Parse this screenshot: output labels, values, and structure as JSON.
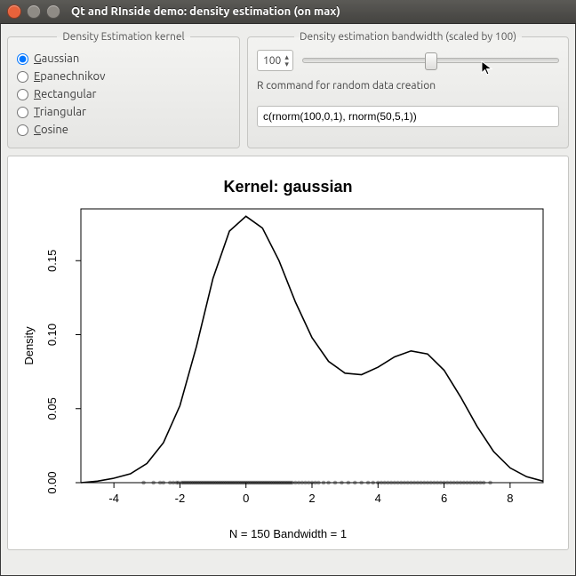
{
  "window": {
    "title": "Qt and RInside demo: density estimation (on max)",
    "buttons": {
      "close": "#e8623b",
      "min": "#8f8b85",
      "max": "#8f8b85"
    }
  },
  "kernel_group": {
    "legend": "Density Estimation kernel",
    "options": [
      {
        "label": "Gaussian",
        "accel": "G",
        "checked": true
      },
      {
        "label": "Epanechnikov",
        "accel": "E",
        "checked": false
      },
      {
        "label": "Rectangular",
        "accel": "R",
        "checked": false
      },
      {
        "label": "Triangular",
        "accel": "T",
        "checked": false
      },
      {
        "label": "Cosine",
        "accel": "C",
        "checked": false
      }
    ]
  },
  "bw_group": {
    "legend": "Density estimation bandwidth (scaled by 100)",
    "spinner_value": "100",
    "slider_pos_pct": 50,
    "cmd_label": "R command for random data creation",
    "cmd_value": "c(rnorm(100,0,1), rnorm(50,5,1))"
  },
  "chart_data": {
    "type": "line",
    "title": "Kernel: gaussian",
    "xlabel": "",
    "ylabel": "Density",
    "xlim": [
      -5,
      9
    ],
    "ylim": [
      0,
      0.185
    ],
    "xticks": [
      -4,
      -2,
      0,
      2,
      4,
      6,
      8
    ],
    "yticks": [
      0.0,
      0.05,
      0.1,
      0.15
    ],
    "caption": "N = 150   Bandwidth = 1",
    "series": [
      {
        "name": "density",
        "x": [
          -5,
          -4.5,
          -4,
          -3.5,
          -3,
          -2.5,
          -2,
          -1.5,
          -1,
          -0.5,
          0,
          0.5,
          1,
          1.5,
          2,
          2.5,
          3,
          3.5,
          4,
          4.5,
          5,
          5.5,
          6,
          6.5,
          7,
          7.5,
          8,
          8.5,
          9
        ],
        "y": [
          0.0,
          0.001,
          0.003,
          0.006,
          0.013,
          0.027,
          0.052,
          0.092,
          0.138,
          0.17,
          0.18,
          0.172,
          0.15,
          0.122,
          0.098,
          0.082,
          0.074,
          0.073,
          0.078,
          0.085,
          0.089,
          0.087,
          0.076,
          0.058,
          0.038,
          0.021,
          0.01,
          0.004,
          0.001
        ]
      }
    ],
    "rug": [
      -3.1,
      -2.8,
      -2.6,
      -2.5,
      -2.3,
      -2.2,
      -2.1,
      -2.05,
      -1.95,
      -1.9,
      -1.85,
      -1.8,
      -1.75,
      -1.7,
      -1.65,
      -1.6,
      -1.55,
      -1.5,
      -1.45,
      -1.4,
      -1.35,
      -1.3,
      -1.25,
      -1.2,
      -1.15,
      -1.1,
      -1.05,
      -1.0,
      -0.95,
      -0.9,
      -0.85,
      -0.8,
      -0.75,
      -0.7,
      -0.65,
      -0.6,
      -0.55,
      -0.5,
      -0.45,
      -0.4,
      -0.35,
      -0.3,
      -0.25,
      -0.2,
      -0.15,
      -0.1,
      -0.05,
      0.0,
      0.05,
      0.1,
      0.15,
      0.2,
      0.25,
      0.3,
      0.35,
      0.4,
      0.45,
      0.5,
      0.55,
      0.6,
      0.65,
      0.7,
      0.75,
      0.8,
      0.85,
      0.9,
      0.95,
      1.0,
      1.05,
      1.1,
      1.15,
      1.2,
      1.25,
      1.3,
      1.35,
      1.4,
      1.5,
      1.6,
      1.7,
      1.8,
      1.9,
      2.0,
      2.1,
      2.2,
      2.35,
      2.5,
      2.7,
      2.9,
      3.1,
      3.3,
      3.5,
      3.7,
      3.85,
      4.0,
      4.1,
      4.2,
      4.3,
      4.4,
      4.5,
      4.6,
      4.7,
      4.8,
      4.9,
      5.0,
      5.1,
      5.2,
      5.3,
      5.4,
      5.5,
      5.6,
      5.7,
      5.8,
      5.9,
      6.0,
      6.1,
      6.2,
      6.3,
      6.4,
      6.5,
      6.6,
      6.7,
      6.8,
      6.9,
      7.0,
      7.1,
      7.2,
      7.4
    ]
  }
}
